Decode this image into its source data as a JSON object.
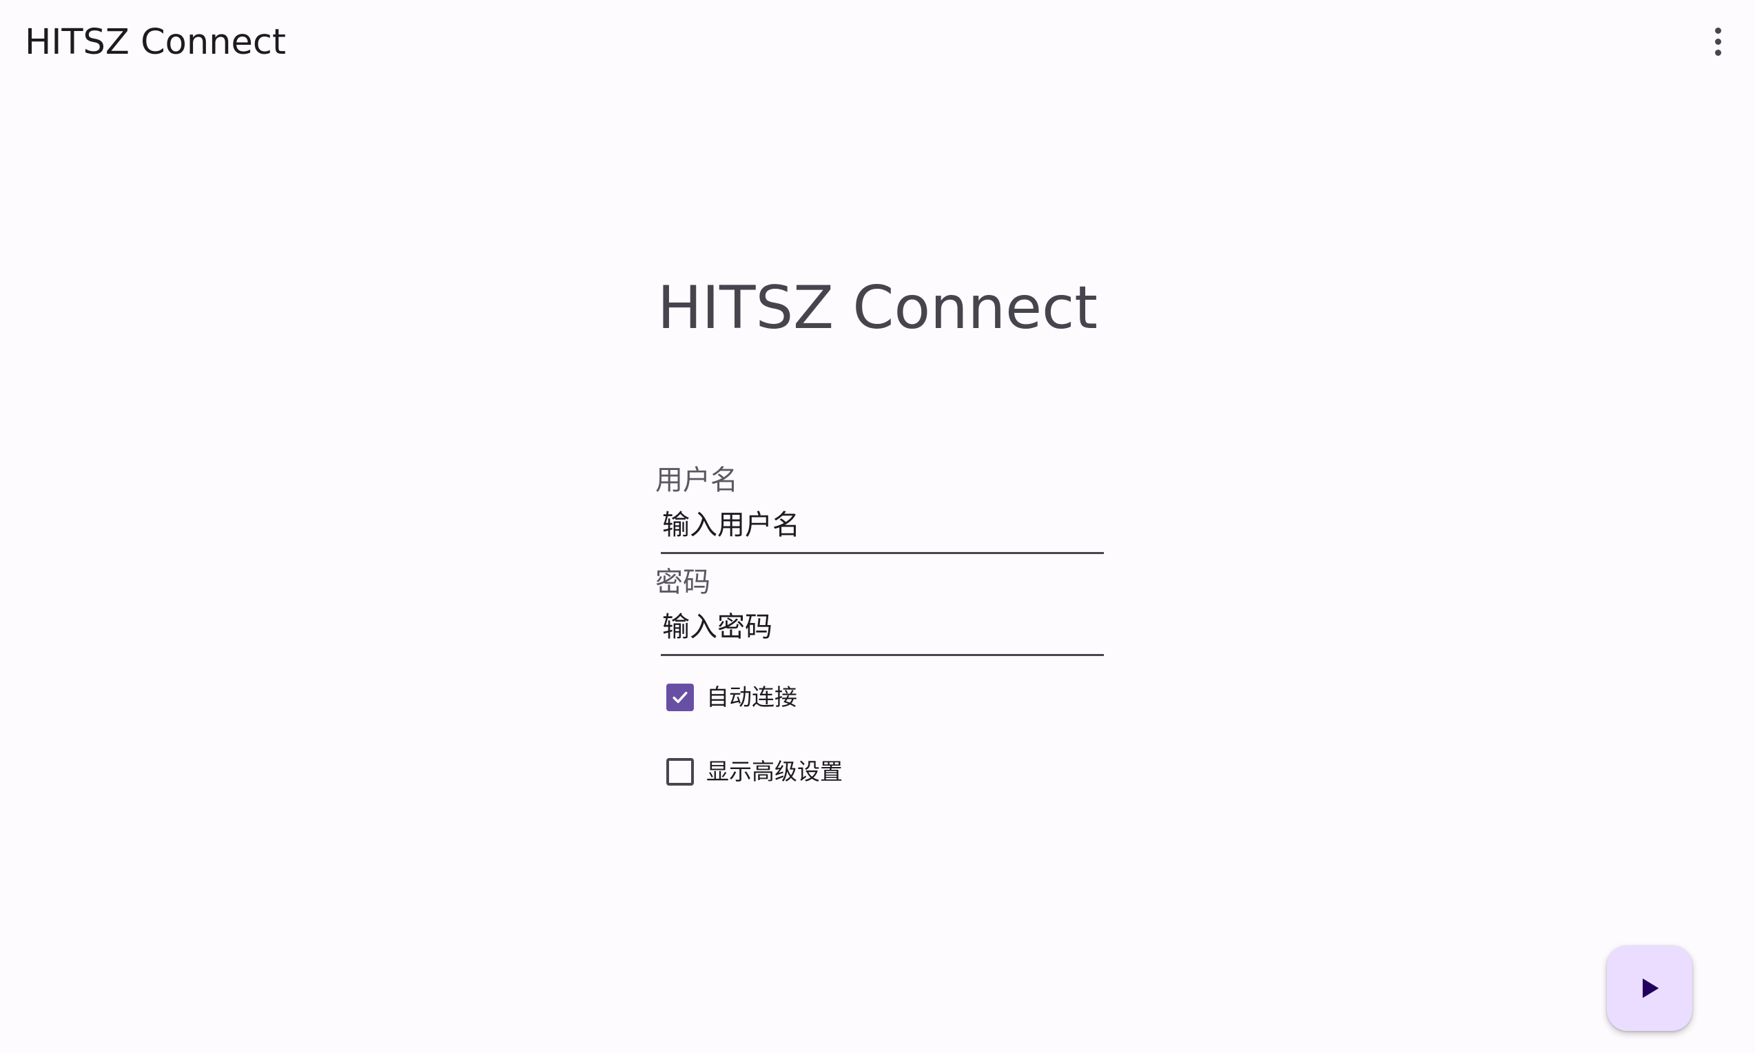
{
  "app_bar": {
    "title": "HITSZ Connect",
    "overflow_icon": "more-vert-icon"
  },
  "main": {
    "heading": "HITSZ Connect"
  },
  "form": {
    "username": {
      "label": "用户名",
      "placeholder": "输入用户名",
      "value": ""
    },
    "password": {
      "label": "密码",
      "placeholder": "输入密码",
      "value": ""
    },
    "auto_connect": {
      "label": "自动连接",
      "checked": true
    },
    "show_advanced": {
      "label": "显示高级设置",
      "checked": false
    }
  },
  "fab": {
    "icon": "play-arrow-icon"
  },
  "colors": {
    "background": "#fefbff",
    "primary": "#6750a4",
    "fab_container": "#eaddff",
    "fab_icon": "#21005d",
    "heading_text": "#46444d"
  }
}
